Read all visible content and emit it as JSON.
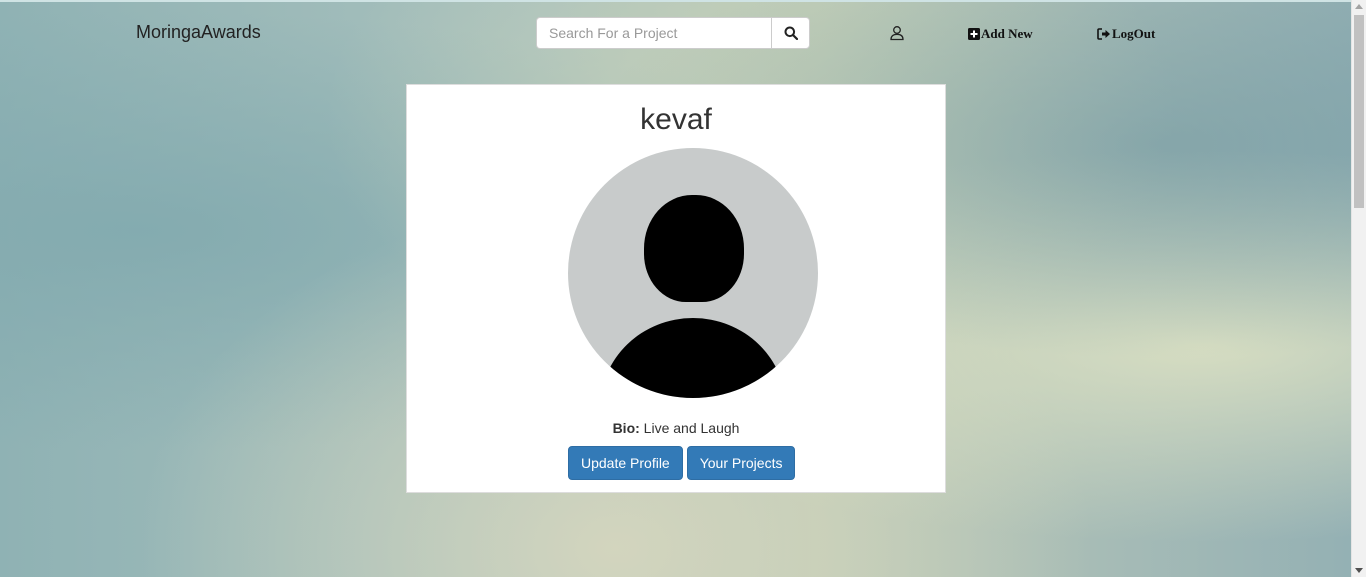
{
  "navbar": {
    "brand": "MoringaAwards",
    "search_placeholder": "Search For a Project",
    "add_new": "Add New",
    "logout": "LogOut"
  },
  "profile": {
    "username": "kevaf",
    "bio_label": "Bio:",
    "bio_text": " Live and Laugh",
    "update_button": "Update Profile",
    "projects_button": "Your Projects"
  },
  "icons": {
    "search": "search-icon",
    "user": "user-icon",
    "add": "plus-square-icon",
    "logout": "logout-icon",
    "avatar": "default-avatar"
  },
  "colors": {
    "primary_button": "#337ab7",
    "avatar_bg": "#c8cbcb"
  }
}
